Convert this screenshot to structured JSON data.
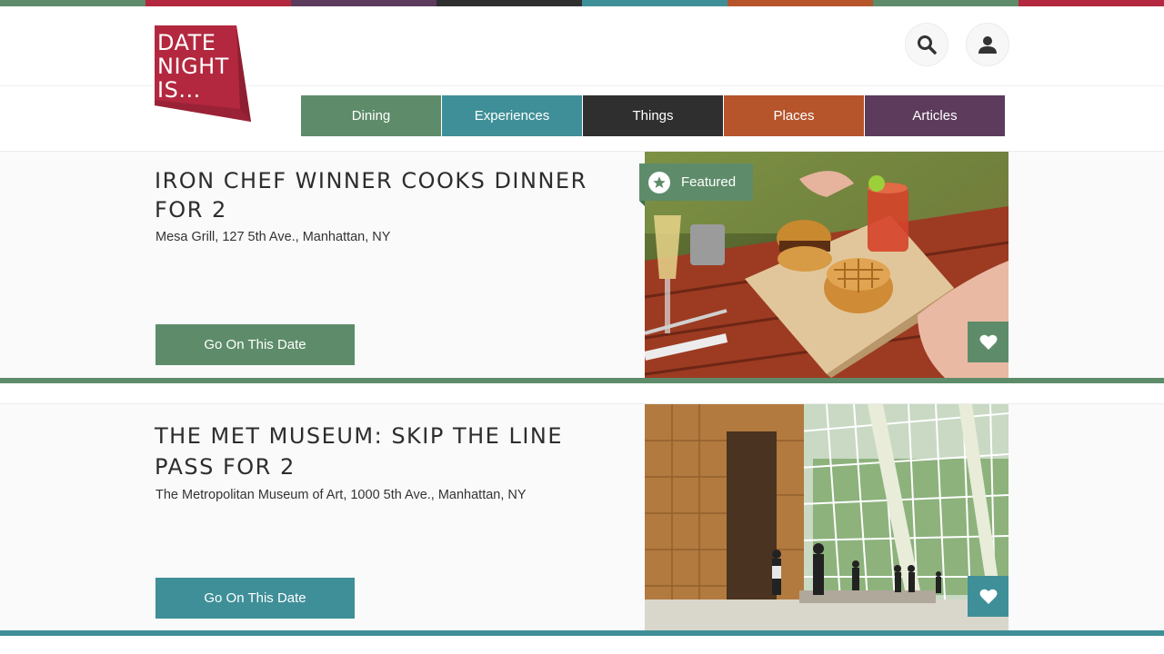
{
  "colors": {
    "green": "#5e8c6a",
    "teal": "#3f8f98",
    "charcoal": "#2f2f2f",
    "orange": "#b6542c",
    "purple": "#5c3b5c",
    "crimson": "#b3283f"
  },
  "logo": {
    "lines": [
      "DATE",
      "NIGHT",
      "IS..."
    ],
    "icon": "date-night-logo"
  },
  "header": {
    "search_icon": "search-icon",
    "user_icon": "user-icon"
  },
  "nav": [
    {
      "label": "Dining"
    },
    {
      "label": "Experiences"
    },
    {
      "label": "Things"
    },
    {
      "label": "Places"
    },
    {
      "label": "Articles"
    }
  ],
  "cards": [
    {
      "title": "IRON CHEF WINNER COOKS DINNER FOR 2",
      "address": "Mesa Grill, 127 5th Ave., Manhattan, NY",
      "cta": "Go On This Date",
      "badge": "Featured",
      "accent": "#5e8c6a",
      "image": "food-photo"
    },
    {
      "title": "THE MET MUSEUM: SKIP THE LINE PASS FOR 2",
      "address": "The Metropolitan Museum of Art, 1000 5th Ave., Manhattan, NY",
      "cta": "Go On This Date",
      "accent": "#3f8f98",
      "image": "museum-photo"
    }
  ]
}
